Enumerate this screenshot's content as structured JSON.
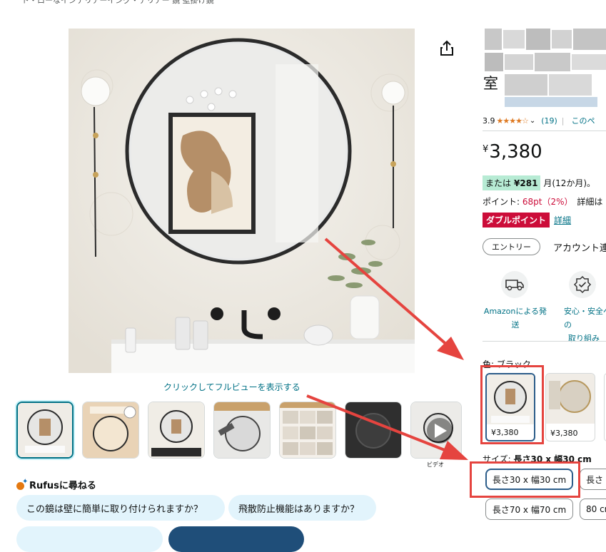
{
  "breadcrumb": "ト・ローなインテリアーイング・テリアー 鏡 壁掛け鏡",
  "main_image": {
    "fullview_hint": "クリックしてフルビューを表示する"
  },
  "thumbnails": {
    "video_label": "ビデオ",
    "items": [
      {
        "name": "round-mirror-bathroom",
        "selected": true
      },
      {
        "name": "size-chart"
      },
      {
        "name": "shatterproof"
      },
      {
        "name": "mounting"
      },
      {
        "name": "features-grid"
      },
      {
        "name": "dark-mirror"
      },
      {
        "name": "video"
      }
    ]
  },
  "rufus": {
    "heading": "Rufusに尋ねる",
    "questions": [
      "この鏡は壁に簡単に取り付けられますか？",
      "飛散防止機能はありますか？"
    ]
  },
  "product": {
    "title_visible_char": "室",
    "rating_value": "3.9",
    "stars": "★★★★☆",
    "rating_count": "(19)",
    "rating_more": "このペ",
    "price_symbol": "¥",
    "price": "3,380",
    "installment_prefix": "または",
    "installment_amount": "¥281",
    "installment_suffix": "月(12か月)。",
    "points_label": "ポイント: ",
    "points_value": "68pt（2%）",
    "points_detail": "詳細は",
    "double_point": "ダブルポイント",
    "double_point_detail": "詳細",
    "entry_button": "エントリー",
    "account_text": "アカウント連"
  },
  "features": [
    {
      "icon": "truck-icon",
      "line1": "Amazonによる発",
      "line2": "送"
    },
    {
      "icon": "shield-check-icon",
      "line1": "安心・安全への",
      "line2": "取り組み"
    }
  ],
  "color": {
    "label": "色: ブラック",
    "swatches": [
      {
        "price": "¥3,380",
        "selected": true
      },
      {
        "price": "¥3,380",
        "selected": false
      }
    ]
  },
  "size": {
    "label_prefix": "サイズ: ",
    "label_value": "長さ30 x 幅30 cm",
    "options": [
      "長さ30 x 幅30 cm",
      "長さ",
      "長さ70 x 幅70 cm",
      "80 cm"
    ]
  },
  "colors": {
    "link": "#007185",
    "accent_red": "#cc0c39",
    "annotation_red": "#e5443f",
    "selected_border": "#2c5d8a",
    "rufus_chip": "#e2f4fc"
  }
}
